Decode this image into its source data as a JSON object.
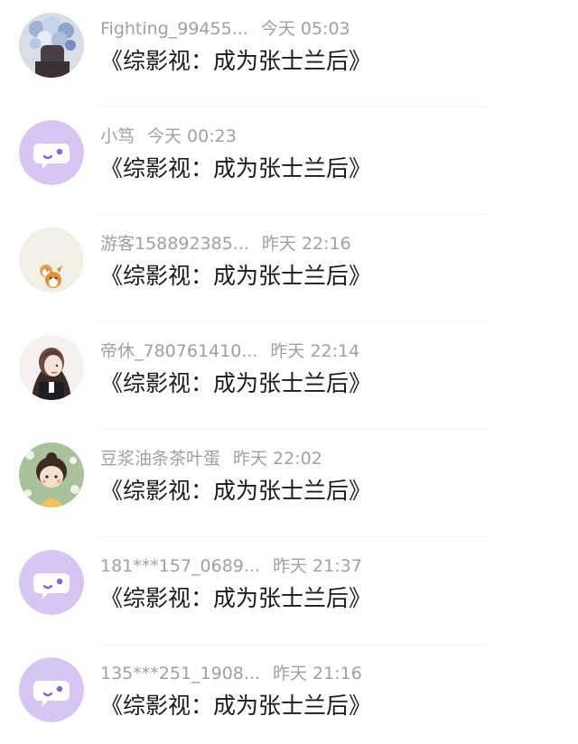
{
  "comments": [
    {
      "username": "Fighting_99455...",
      "time": "今天 05:03",
      "text": "《综影视：成为张士兰后》",
      "avatar": "flower-photo-avatar"
    },
    {
      "username": "小笃",
      "time": "今天 00:23",
      "text": "《综影视：成为张士兰后》",
      "avatar": "default-chat-bubble-avatar"
    },
    {
      "username": "游客158892385...",
      "time": "昨天 22:16",
      "text": "《综影视：成为张士兰后》",
      "avatar": "shiba-dogs-avatar"
    },
    {
      "username": "帝休_780761410...",
      "time": "昨天 22:14",
      "text": "《综影视：成为张士兰后》",
      "avatar": "illustrated-girl-avatar"
    },
    {
      "username": "豆浆油条茶叶蛋",
      "time": "昨天 22:02",
      "text": "《综影视：成为张士兰后》",
      "avatar": "cartoon-character-avatar"
    },
    {
      "username": "181***157_0689...",
      "time": "昨天 21:37",
      "text": "《综影视：成为张士兰后》",
      "avatar": "default-chat-bubble-avatar"
    },
    {
      "username": "135***251_1908...",
      "time": "昨天 21:16",
      "text": "《综影视：成为张士兰后》",
      "avatar": "default-chat-bubble-avatar"
    }
  ],
  "colors": {
    "default_avatar_bg": "#d7c5f3",
    "default_avatar_accent": "#8a63d2",
    "meta_text": "#a0a0a4",
    "comment_text": "#1a1a1a"
  }
}
